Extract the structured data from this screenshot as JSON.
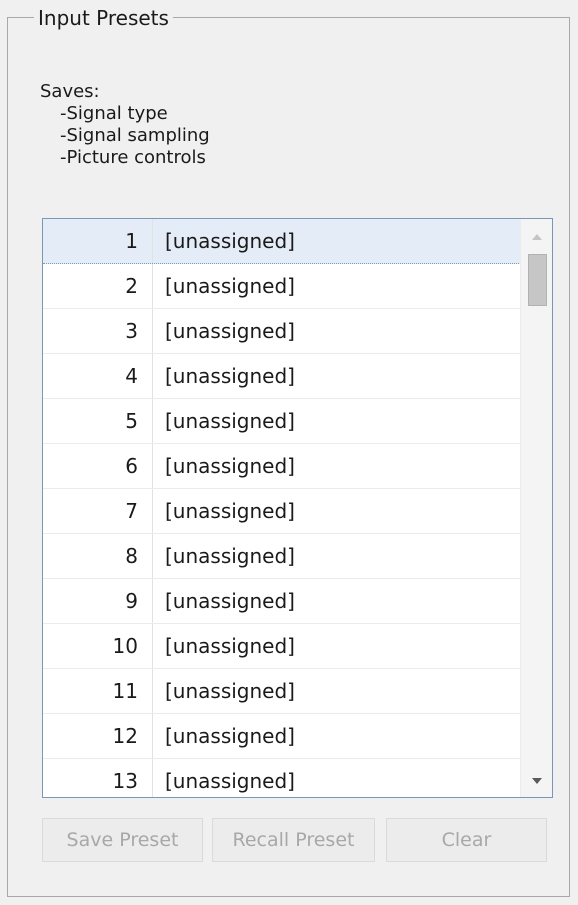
{
  "group": {
    "title": "Input Presets"
  },
  "saves": {
    "heading": "Saves:",
    "items": [
      "-Signal type",
      "-Signal sampling",
      "-Picture controls"
    ]
  },
  "presets": {
    "selected_index": 0,
    "rows": [
      {
        "number": "1",
        "name": "[unassigned]"
      },
      {
        "number": "2",
        "name": "[unassigned]"
      },
      {
        "number": "3",
        "name": "[unassigned]"
      },
      {
        "number": "4",
        "name": "[unassigned]"
      },
      {
        "number": "5",
        "name": "[unassigned]"
      },
      {
        "number": "6",
        "name": "[unassigned]"
      },
      {
        "number": "7",
        "name": "[unassigned]"
      },
      {
        "number": "8",
        "name": "[unassigned]"
      },
      {
        "number": "9",
        "name": "[unassigned]"
      },
      {
        "number": "10",
        "name": "[unassigned]"
      },
      {
        "number": "11",
        "name": "[unassigned]"
      },
      {
        "number": "12",
        "name": "[unassigned]"
      },
      {
        "number": "13",
        "name": "[unassigned]"
      }
    ]
  },
  "buttons": {
    "save_label": "Save Preset",
    "recall_label": "Recall Preset",
    "clear_label": "Clear",
    "enabled": false
  },
  "icons": {
    "scroll_up": "triangle-up-icon",
    "scroll_down": "triangle-down-icon"
  },
  "colors": {
    "selection": "#e4ecf7",
    "list_border": "#7a96b8",
    "disabled_text": "#a8a8a8"
  }
}
